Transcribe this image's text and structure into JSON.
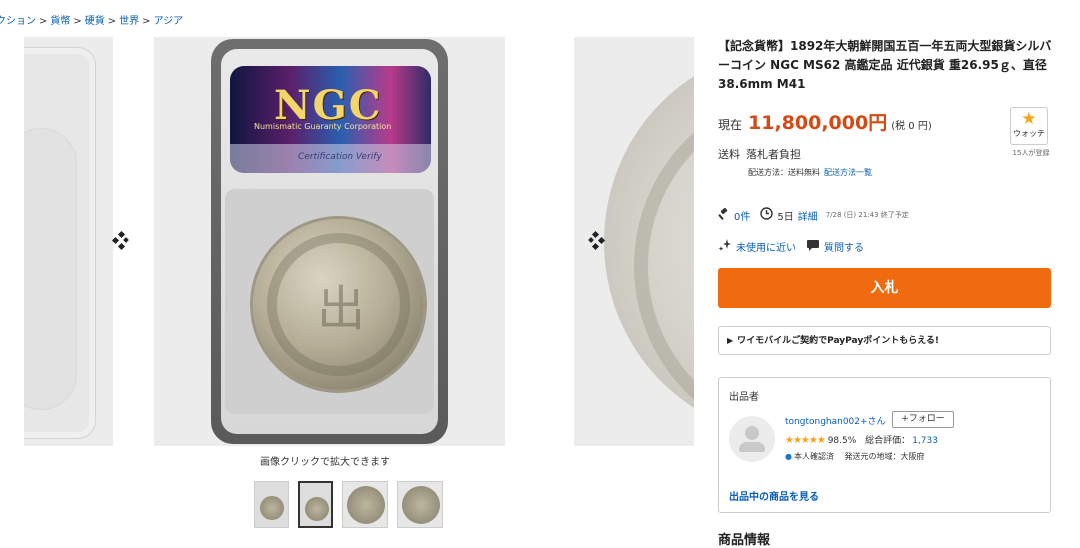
{
  "breadcrumb": [
    "クション",
    "貨幣",
    "硬貨",
    "世界",
    "アジア"
  ],
  "gallery": {
    "caption": "画像クリックで拡大できます",
    "ngc_logo": "NGC",
    "ngc_corp": "Numismatic Guaranty Corporation",
    "ngc_verify": "Certification Verify"
  },
  "item": {
    "title": "【記念貨幣】1892年大朝鮮開国五百一年五両大型銀貨シルバーコイン NGC MS62 高鑑定品 近代銀貨 重26.95ｇ、直径38.6mm M41",
    "price_label": "現在",
    "price": "11,800,000円",
    "tax": "(税 0 円)",
    "watch_label": "ウォッチ",
    "watch_count": "15人が登録",
    "shipping_label": "送料",
    "shipping_value": "落札者負担",
    "shipping_method": "配送方法：送料無料",
    "shipping_link": "配送方法一覧",
    "bids": "0件",
    "time_left": "5日",
    "detail_link": "詳細",
    "end_time": "7/28 (日) 21:43 終了予定",
    "condition": "未使用に近い",
    "question": "質問する",
    "bid_button": "入札",
    "promo": "ワイモバイルご契約でPayPayポイントもらえる!"
  },
  "seller": {
    "heading": "出品者",
    "name": "tongtonghan002+さん",
    "follow": "+フォロー",
    "rating_pct": "98.5%",
    "rating_label": "総合評価：",
    "rating_count": "1,733",
    "verified": "本人確認済",
    "region": "発送元の地域：大阪府",
    "items_link": "出品中の商品を見る"
  },
  "section_title": "商品情報"
}
